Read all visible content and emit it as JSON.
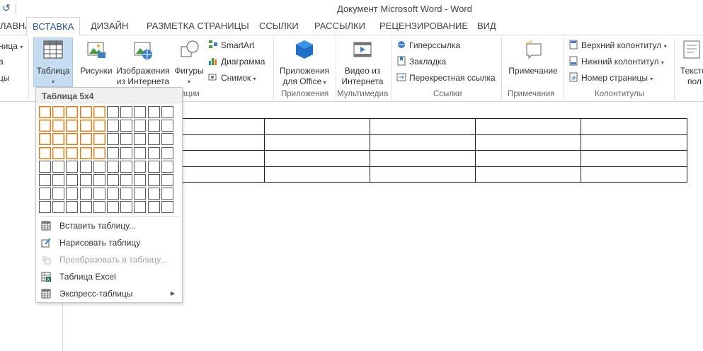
{
  "window": {
    "title": "Документ Microsoft Word - Word"
  },
  "tabs": [
    {
      "label": "ЛАВНАЯ"
    },
    {
      "label": "ВСТАВКА"
    },
    {
      "label": "ДИЗАЙН"
    },
    {
      "label": "РАЗМЕТКА СТРАНИЦЫ"
    },
    {
      "label": "ССЫЛКИ"
    },
    {
      "label": "РАССЫЛКИ"
    },
    {
      "label": "РЕЦЕНЗИРОВАНИЕ"
    },
    {
      "label": "ВИД"
    }
  ],
  "ribbon": {
    "left_partial": [
      "ница",
      "а",
      "цы"
    ],
    "table_btn": {
      "line1": "Таблица",
      "line2": "▾"
    },
    "pictures": "Рисунки",
    "online_images": {
      "line1": "Изображения",
      "line2": "из Интернета"
    },
    "shapes": {
      "line1": "Фигуры",
      "line2": "▾"
    },
    "smartart": "SmartArt",
    "chart": "Диаграмма",
    "screenshot": "Снимок",
    "illustrations_group_partial": "ации",
    "apps": {
      "line1": "Приложения",
      "line2": "для Office"
    },
    "apps_group": "Приложения",
    "video": {
      "line1": "Видео из",
      "line2": "Интернета"
    },
    "media_group": "Мультимедиа",
    "hyperlink": "Гиперссылка",
    "bookmark": "Закладка",
    "crossref": "Перекрестная ссылка",
    "links_group": "Ссылки",
    "comment": "Примечание",
    "comments_group": "Примечания",
    "header": "Верхний колонтитул",
    "footer": "Нижний колонтитул",
    "page_number": "Номер страницы",
    "headers_group": "Колонтитулы",
    "textbox_partial": {
      "line1": "Тексто",
      "line2": "пол"
    }
  },
  "dropdown": {
    "header": "Таблица 5x4",
    "grid": {
      "cols": 10,
      "rows": 8,
      "sel_cols": 5,
      "sel_rows": 4
    },
    "items": [
      {
        "label": "Вставить таблицу...",
        "icon": "insert-table-icon",
        "disabled": false,
        "submenu": false
      },
      {
        "label": "Нарисовать таблицу",
        "icon": "draw-table-icon",
        "disabled": false,
        "submenu": false
      },
      {
        "label": "Преобразовать в таблицу...",
        "icon": "convert-table-icon",
        "disabled": true,
        "submenu": false
      },
      {
        "label": "Таблица Excel",
        "icon": "excel-icon",
        "disabled": false,
        "submenu": false
      },
      {
        "label": "Экспресс-таблицы",
        "icon": "quick-tables-icon",
        "disabled": false,
        "submenu": true
      }
    ]
  },
  "document": {
    "table": {
      "rows": 4,
      "cols": 5
    }
  },
  "colors": {
    "accent": "#2b579a",
    "selection": "#e07b1f",
    "button_pressed": "#c5dcf1"
  }
}
